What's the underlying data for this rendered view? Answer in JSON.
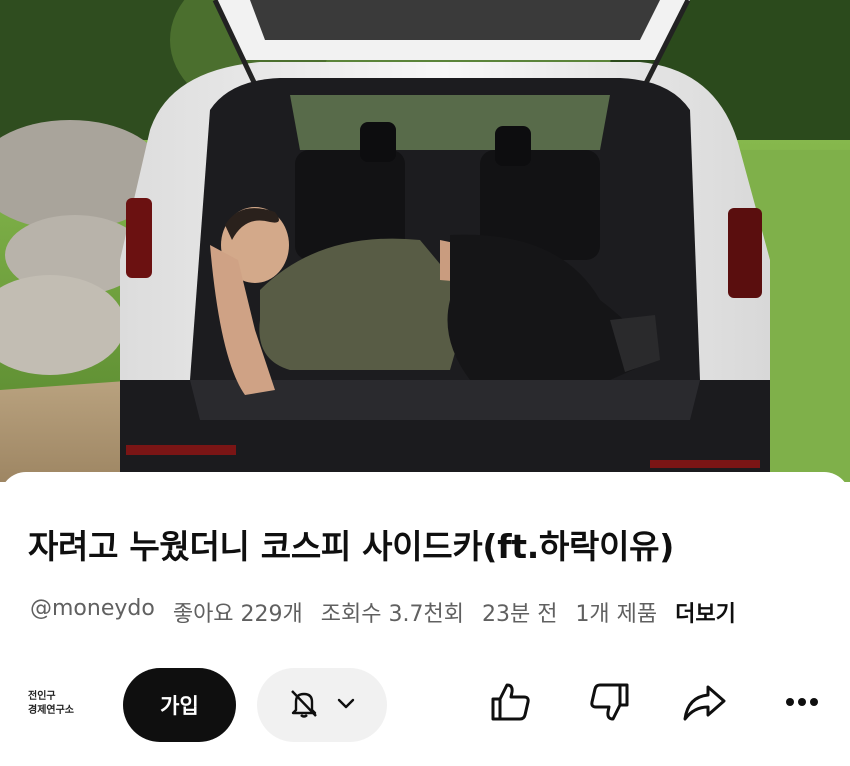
{
  "video": {
    "title": "자려고 누웠더니 코스피 사이드카(ft.하락이유)",
    "channel_handle": "@moneydo",
    "likes": "좋아요 229개",
    "views": "조회수 3.7천회",
    "time_ago": "23분 전",
    "products": "1개 제품",
    "more_label": "더보기"
  },
  "channel": {
    "logo_line1": "전인구",
    "logo_line2": "경제연구소"
  },
  "actions": {
    "join_label": "가입",
    "bell_icon": "bell-off-icon",
    "chevron_icon": "chevron-down-icon",
    "like_icon": "thumbs-up-icon",
    "dislike_icon": "thumbs-down-icon",
    "share_icon": "share-icon",
    "more_icon": "more-horizontal-icon"
  },
  "colors": {
    "text_primary": "#0f0f0f",
    "text_secondary": "#606060",
    "join_bg": "#0f0f0f",
    "bell_bg": "#f1f1f1"
  }
}
